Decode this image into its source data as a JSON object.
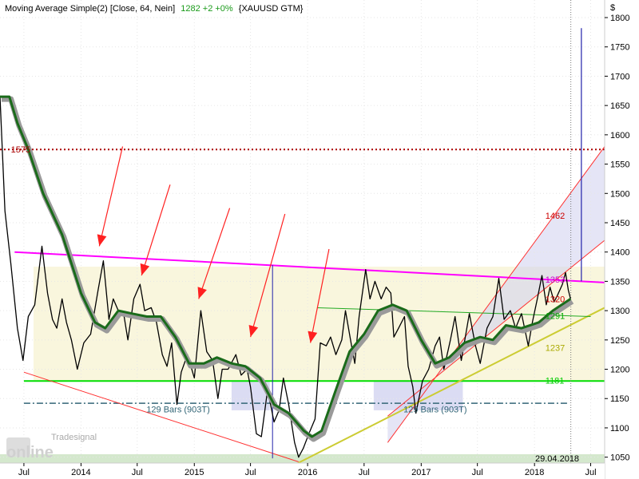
{
  "header": {
    "indicator": "Moving Average Simple(2) [Close, 64, Nein]",
    "quote": "1282 +2 +0%",
    "symbol": "{XAUUSD GTM}"
  },
  "watermark": {
    "brand": "Tradesignal",
    "product": "online"
  },
  "colors": {
    "price": "#000000",
    "ma": "#1a6b1a",
    "ma_shadow": "#9a9a9a",
    "resistance": "#ff00ff",
    "support": "#00dd00",
    "level_1575": "#aa0000",
    "channel": "#ff3030",
    "trend_yellow": "#cccc33",
    "arrow": "#ff2020",
    "zone_yellow": "#f7f3d2",
    "zone_blue": "#cfd0ef",
    "zone_green": "#cfe6c8",
    "dashdot": "#336677"
  },
  "chart_data": {
    "type": "line",
    "title": "Moving Average Simple(2) [Close, 64, Nein] 1282 +2 +0% {XAUUSD GTM}",
    "ylabel": "$",
    "ylim": [
      1040,
      1830
    ],
    "x_range": [
      "2013-04-15",
      "2018-08-15"
    ],
    "y_ticks": [
      1050,
      1100,
      1150,
      1200,
      1250,
      1300,
      1350,
      1400,
      1450,
      1500,
      1550,
      1600,
      1650,
      1700,
      1750,
      1800
    ],
    "x_ticks": [
      {
        "date": "2013-07-01",
        "label": "Jul"
      },
      {
        "date": "2014-01-01",
        "label": "2014"
      },
      {
        "date": "2014-07-01",
        "label": "Jul"
      },
      {
        "date": "2015-01-01",
        "label": "2015"
      },
      {
        "date": "2015-07-01",
        "label": "Jul"
      },
      {
        "date": "2016-01-01",
        "label": "2016"
      },
      {
        "date": "2016-07-01",
        "label": "Jul"
      },
      {
        "date": "2017-01-01",
        "label": "2017"
      },
      {
        "date": "2017-07-01",
        "label": "Jul"
      },
      {
        "date": "2018-01-01",
        "label": "2018"
      },
      {
        "date": "2018-07-01",
        "label": "Jul"
      }
    ],
    "series": [
      {
        "key": "price",
        "points": [
          [
            "2013-04-15",
            1665
          ],
          [
            "2013-05-01",
            1470
          ],
          [
            "2013-05-20",
            1380
          ],
          [
            "2013-06-10",
            1270
          ],
          [
            "2013-06-28",
            1215
          ],
          [
            "2013-07-15",
            1290
          ],
          [
            "2013-08-05",
            1310
          ],
          [
            "2013-08-28",
            1410
          ],
          [
            "2013-09-15",
            1330
          ],
          [
            "2013-10-01",
            1285
          ],
          [
            "2013-10-15",
            1270
          ],
          [
            "2013-11-01",
            1320
          ],
          [
            "2013-11-15",
            1280
          ],
          [
            "2013-12-01",
            1250
          ],
          [
            "2013-12-20",
            1200
          ],
          [
            "2014-01-10",
            1245
          ],
          [
            "2014-02-01",
            1260
          ],
          [
            "2014-02-25",
            1335
          ],
          [
            "2014-03-14",
            1385
          ],
          [
            "2014-04-01",
            1285
          ],
          [
            "2014-04-15",
            1320
          ],
          [
            "2014-05-01",
            1300
          ],
          [
            "2014-05-20",
            1290
          ],
          [
            "2014-06-01",
            1250
          ],
          [
            "2014-06-20",
            1320
          ],
          [
            "2014-07-10",
            1345
          ],
          [
            "2014-07-25",
            1300
          ],
          [
            "2014-08-15",
            1305
          ],
          [
            "2014-09-01",
            1280
          ],
          [
            "2014-09-20",
            1225
          ],
          [
            "2014-10-05",
            1205
          ],
          [
            "2014-10-20",
            1245
          ],
          [
            "2014-11-06",
            1140
          ],
          [
            "2014-11-20",
            1195
          ],
          [
            "2014-12-10",
            1225
          ],
          [
            "2015-01-01",
            1185
          ],
          [
            "2015-01-22",
            1300
          ],
          [
            "2015-02-10",
            1230
          ],
          [
            "2015-03-01",
            1215
          ],
          [
            "2015-03-18",
            1150
          ],
          [
            "2015-04-01",
            1200
          ],
          [
            "2015-04-20",
            1200
          ],
          [
            "2015-05-15",
            1225
          ],
          [
            "2015-06-01",
            1190
          ],
          [
            "2015-06-20",
            1200
          ],
          [
            "2015-07-01",
            1170
          ],
          [
            "2015-07-20",
            1090
          ],
          [
            "2015-08-05",
            1085
          ],
          [
            "2015-08-25",
            1165
          ],
          [
            "2015-09-15",
            1110
          ],
          [
            "2015-10-01",
            1130
          ],
          [
            "2015-10-15",
            1185
          ],
          [
            "2015-11-01",
            1140
          ],
          [
            "2015-11-20",
            1075
          ],
          [
            "2015-12-03",
            1050
          ],
          [
            "2015-12-18",
            1065
          ],
          [
            "2016-01-05",
            1090
          ],
          [
            "2016-01-25",
            1115
          ],
          [
            "2016-02-11",
            1245
          ],
          [
            "2016-03-01",
            1240
          ],
          [
            "2016-03-15",
            1255
          ],
          [
            "2016-04-01",
            1225
          ],
          [
            "2016-04-20",
            1250
          ],
          [
            "2016-05-02",
            1300
          ],
          [
            "2016-05-20",
            1245
          ],
          [
            "2016-06-01",
            1210
          ],
          [
            "2016-06-15",
            1290
          ],
          [
            "2016-07-06",
            1370
          ],
          [
            "2016-07-20",
            1320
          ],
          [
            "2016-08-05",
            1350
          ],
          [
            "2016-08-25",
            1320
          ],
          [
            "2016-09-10",
            1340
          ],
          [
            "2016-09-25",
            1330
          ],
          [
            "2016-10-05",
            1255
          ],
          [
            "2016-10-20",
            1270
          ],
          [
            "2016-11-08",
            1290
          ],
          [
            "2016-11-20",
            1205
          ],
          [
            "2016-12-05",
            1170
          ],
          [
            "2016-12-15",
            1125
          ],
          [
            "2017-01-05",
            1180
          ],
          [
            "2017-01-25",
            1200
          ],
          [
            "2017-02-15",
            1240
          ],
          [
            "2017-03-01",
            1255
          ],
          [
            "2017-03-15",
            1200
          ],
          [
            "2017-04-05",
            1250
          ],
          [
            "2017-04-20",
            1290
          ],
          [
            "2017-05-10",
            1215
          ],
          [
            "2017-06-05",
            1295
          ],
          [
            "2017-06-25",
            1240
          ],
          [
            "2017-07-10",
            1210
          ],
          [
            "2017-08-01",
            1270
          ],
          [
            "2017-08-20",
            1290
          ],
          [
            "2017-09-08",
            1355
          ],
          [
            "2017-09-25",
            1285
          ],
          [
            "2017-10-15",
            1300
          ],
          [
            "2017-11-01",
            1270
          ],
          [
            "2017-11-20",
            1295
          ],
          [
            "2017-12-12",
            1240
          ],
          [
            "2017-12-25",
            1280
          ],
          [
            "2018-01-10",
            1320
          ],
          [
            "2018-01-25",
            1360
          ],
          [
            "2018-02-08",
            1310
          ],
          [
            "2018-02-20",
            1340
          ],
          [
            "2018-03-05",
            1315
          ],
          [
            "2018-03-15",
            1325
          ],
          [
            "2018-04-01",
            1345
          ],
          [
            "2018-04-11",
            1365
          ],
          [
            "2018-04-20",
            1335
          ],
          [
            "2018-04-27",
            1320
          ]
        ]
      },
      {
        "key": "sma",
        "name": "Moving Average Simple(2) [Close, 64, Nein]",
        "points": [
          [
            "2013-04-15",
            1665
          ],
          [
            "2013-05-15",
            1665
          ],
          [
            "2013-06-10",
            1620
          ],
          [
            "2013-07-15",
            1575
          ],
          [
            "2013-09-01",
            1500
          ],
          [
            "2013-11-01",
            1430
          ],
          [
            "2014-01-01",
            1330
          ],
          [
            "2014-02-15",
            1280
          ],
          [
            "2014-03-20",
            1270
          ],
          [
            "2014-05-01",
            1300
          ],
          [
            "2014-06-15",
            1295
          ],
          [
            "2014-08-01",
            1290
          ],
          [
            "2014-09-15",
            1290
          ],
          [
            "2014-11-01",
            1255
          ],
          [
            "2014-12-15",
            1210
          ],
          [
            "2015-02-01",
            1210
          ],
          [
            "2015-03-15",
            1220
          ],
          [
            "2015-05-01",
            1210
          ],
          [
            "2015-06-15",
            1205
          ],
          [
            "2015-08-01",
            1185
          ],
          [
            "2015-09-15",
            1140
          ],
          [
            "2015-11-01",
            1125
          ],
          [
            "2015-12-20",
            1095
          ],
          [
            "2016-01-15",
            1085
          ],
          [
            "2016-02-15",
            1095
          ],
          [
            "2016-04-01",
            1165
          ],
          [
            "2016-05-15",
            1230
          ],
          [
            "2016-07-01",
            1260
          ],
          [
            "2016-08-15",
            1300
          ],
          [
            "2016-10-01",
            1310
          ],
          [
            "2016-11-15",
            1300
          ],
          [
            "2017-01-01",
            1250
          ],
          [
            "2017-02-15",
            1210
          ],
          [
            "2017-04-01",
            1220
          ],
          [
            "2017-05-20",
            1245
          ],
          [
            "2017-07-10",
            1255
          ],
          [
            "2017-08-20",
            1250
          ],
          [
            "2017-10-01",
            1275
          ],
          [
            "2017-11-20",
            1270
          ],
          [
            "2018-01-15",
            1280
          ],
          [
            "2018-03-01",
            1300
          ],
          [
            "2018-04-27",
            1320
          ]
        ]
      }
    ],
    "lines": [
      {
        "key": "level_1575",
        "from": [
          "2013-04-15",
          1575
        ],
        "to": [
          "2018-08-15",
          1575
        ],
        "style": "dotted"
      },
      {
        "key": "resistance",
        "from": [
          "2013-06-01",
          1400
        ],
        "to": [
          "2018-08-15",
          1348
        ]
      },
      {
        "key": "support",
        "from": [
          "2013-07-01",
          1180
        ],
        "to": [
          "2018-08-15",
          1180
        ]
      },
      {
        "key": "dashdot",
        "from": [
          "2013-07-01",
          1142
        ],
        "to": [
          "2018-04-20",
          1142
        ],
        "style": "dashdot"
      },
      {
        "key": "channel",
        "from": [
          "2013-07-01",
          1195
        ],
        "to": [
          "2015-12-03",
          1042
        ]
      },
      {
        "key": "channel",
        "from": [
          "2016-09-15",
          1075
        ],
        "to": [
          "2018-08-15",
          1580
        ]
      },
      {
        "key": "channel",
        "from": [
          "2016-09-15",
          1120
        ],
        "to": [
          "2018-08-15",
          1420
        ]
      },
      {
        "key": "trend_yellow",
        "from": [
          "2015-12-01",
          1040
        ],
        "to": [
          "2018-08-15",
          1305
        ]
      },
      {
        "key": "thin_green",
        "from": [
          "2016-02-01",
          1305
        ],
        "to": [
          "2018-07-01",
          1290
        ]
      }
    ],
    "zones": [
      {
        "key": "zone_yellow",
        "x": [
          "2013-08-01",
          "2018-08-15"
        ],
        "y": [
          1180,
          1375
        ]
      },
      {
        "key": "zone_blue",
        "x": [
          "2015-05-01",
          "2015-09-01"
        ],
        "y": [
          1130,
          1180
        ]
      },
      {
        "key": "zone_blue",
        "x": [
          "2016-08-01",
          "2017-05-15"
        ],
        "y": [
          1130,
          1180
        ]
      },
      {
        "key": "zone_green",
        "x": [
          "2013-04-15",
          "2018-08-15"
        ],
        "y": [
          1040,
          1055
        ]
      }
    ],
    "arrows": [
      {
        "from": [
          "2014-05-15",
          1580
        ],
        "to": [
          "2014-03-01",
          1410
        ]
      },
      {
        "from": [
          "2014-10-15",
          1515
        ],
        "to": [
          "2014-07-15",
          1360
        ]
      },
      {
        "from": [
          "2015-04-25",
          1475
        ],
        "to": [
          "2015-01-15",
          1320
        ]
      },
      {
        "from": [
          "2015-10-20",
          1465
        ],
        "to": [
          "2015-07-01",
          1255
        ]
      },
      {
        "from": [
          "2016-03-10",
          1405
        ],
        "to": [
          "2016-01-10",
          1245
        ]
      }
    ],
    "annotations": [
      {
        "date": "2013-05-20",
        "value": 1575,
        "text": "1575",
        "color": "#aa0000",
        "anchor": "start"
      },
      {
        "date": "2018-02-05",
        "value": 1462,
        "text": "1462",
        "color": "#cc0000",
        "anchor": "start"
      },
      {
        "date": "2018-02-05",
        "value": 1353,
        "text": "1353",
        "color": "#cc00cc",
        "anchor": "start"
      },
      {
        "date": "2018-02-05",
        "value": 1320,
        "text": "1320",
        "color": "#cc0000",
        "anchor": "start"
      },
      {
        "date": "2018-02-05",
        "value": 1291,
        "text": "1291",
        "color": "#00aa00",
        "anchor": "start"
      },
      {
        "date": "2018-02-05",
        "value": 1237,
        "text": "1237",
        "color": "#aaaa00",
        "anchor": "start"
      },
      {
        "date": "2018-02-05",
        "value": 1181,
        "text": "1181",
        "color": "#00cc00",
        "anchor": "start"
      },
      {
        "date": "2014-11-10",
        "value": 1132,
        "text": "129 Bars (903T)",
        "color": "#336677",
        "anchor": "middle"
      },
      {
        "date": "2017-02-15",
        "value": 1132,
        "text": "129 Bars (903T)",
        "color": "#336677",
        "anchor": "middle"
      },
      {
        "date": "2018-03-15",
        "value": 1048,
        "text": "29.04.2018",
        "color": "#000000",
        "anchor": "middle"
      }
    ]
  }
}
